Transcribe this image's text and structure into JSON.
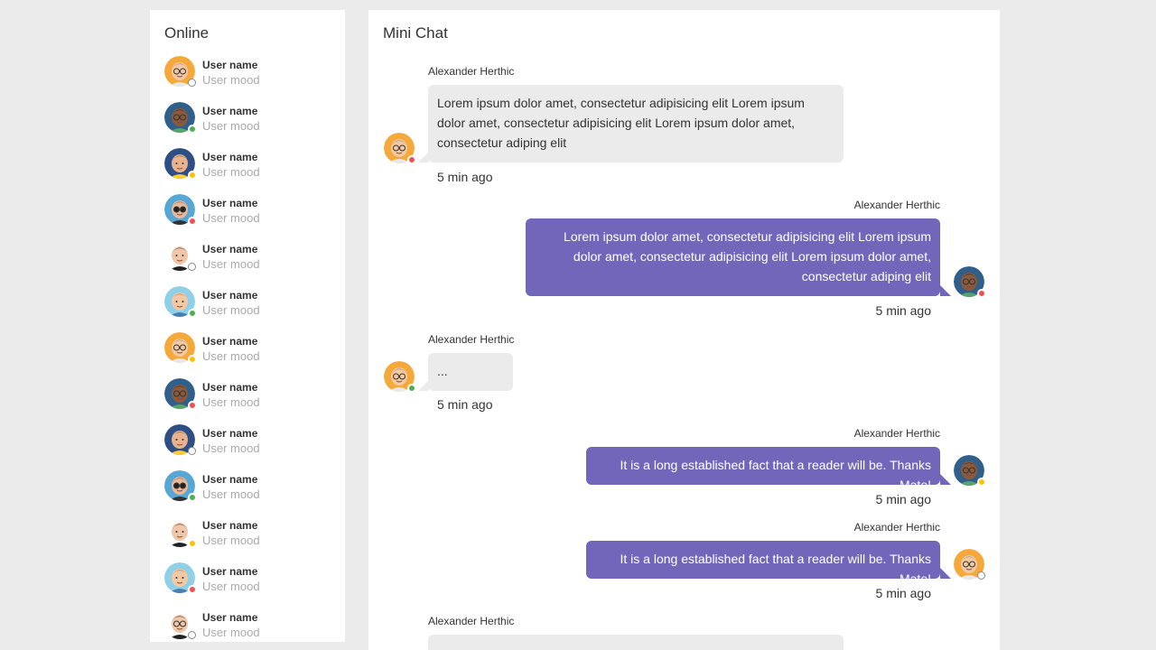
{
  "online": {
    "title": "Online",
    "users": [
      {
        "name": "User name",
        "mood": "User mood",
        "avatar": "glasses-bald-avatar",
        "status": "offline"
      },
      {
        "name": "User name",
        "mood": "User mood",
        "avatar": "glasses-dark-avatar",
        "status": "online"
      },
      {
        "name": "User name",
        "mood": "User mood",
        "avatar": "brown-hair-avatar",
        "status": "away"
      },
      {
        "name": "User name",
        "mood": "User mood",
        "avatar": "sunglasses-avatar",
        "status": "busy"
      },
      {
        "name": "User name",
        "mood": "User mood",
        "avatar": "black-hair-avatar",
        "status": "offline"
      },
      {
        "name": "User name",
        "mood": "User mood",
        "avatar": "red-hair-avatar",
        "status": "online"
      },
      {
        "name": "User name",
        "mood": "User mood",
        "avatar": "glasses-bald-avatar",
        "status": "away"
      },
      {
        "name": "User name",
        "mood": "User mood",
        "avatar": "glasses-dark-avatar",
        "status": "busy"
      },
      {
        "name": "User name",
        "mood": "User mood",
        "avatar": "brown-hair-avatar",
        "status": "offline"
      },
      {
        "name": "User name",
        "mood": "User mood",
        "avatar": "sunglasses-avatar",
        "status": "online"
      },
      {
        "name": "User name",
        "mood": "User mood",
        "avatar": "black-hair-avatar",
        "status": "away"
      },
      {
        "name": "User name",
        "mood": "User mood",
        "avatar": "red-hair-avatar",
        "status": "busy"
      },
      {
        "name": "User name",
        "mood": "User mood",
        "avatar": "glasses-black-avatar",
        "status": "offline"
      }
    ]
  },
  "chat": {
    "title": "Mini Chat",
    "messages": [
      {
        "sender": "Alexander Herthic",
        "side": "left",
        "text": "Lorem ipsum dolor amet, consectetur adipisicing elit Lorem ipsum dolor amet, consectetur adipisicing elit Lorem ipsum dolor amet, consectetur adiping elit",
        "time": "5 min ago",
        "avatar": "glasses-bald-avatar",
        "status": "busy"
      },
      {
        "sender": "Alexander Herthic",
        "side": "right",
        "text": "Lorem ipsum dolor amet, consectetur adipisicing elit Lorem ipsum dolor amet, consectetur adipisicing elit Lorem ipsum dolor amet, consectetur adiping elit",
        "time": "5 min ago",
        "avatar": "glasses-dark-avatar",
        "status": "busy"
      },
      {
        "sender": "Alexander Herthic",
        "side": "left",
        "text": "...",
        "time": "5 min ago",
        "avatar": "glasses-bald-avatar",
        "status": "online"
      },
      {
        "sender": "Alexander Herthic",
        "side": "right",
        "text": "It is a long established fact that a reader will be. Thanks Mate!",
        "time": "5 min ago",
        "avatar": "glasses-dark-avatar",
        "status": "away"
      },
      {
        "sender": "Alexander Herthic",
        "side": "right",
        "text": "It is a long established fact that a reader will be. Thanks Mate!",
        "time": "5 min ago",
        "avatar": "glasses-bald-avatar",
        "status": "offline"
      },
      {
        "sender": "Alexander Herthic",
        "side": "left",
        "text": "",
        "time": "",
        "avatar": "",
        "status": ""
      }
    ]
  },
  "colors": {
    "background": "#ebebeb",
    "panel": "#ffffff",
    "bubble_left": "#ebebeb",
    "bubble_right": "#7266ba",
    "status_online": "#4caf50",
    "status_away": "#ffc107",
    "status_busy": "#f05050",
    "status_offline": "#ffffff"
  }
}
